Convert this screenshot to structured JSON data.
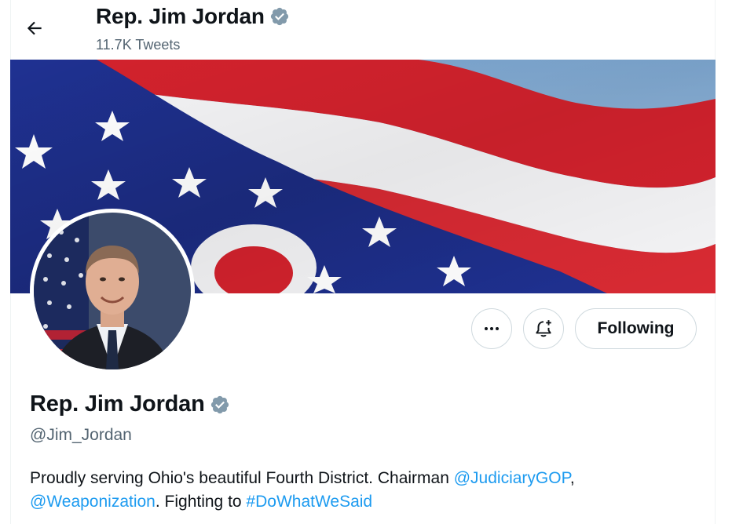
{
  "header": {
    "back_icon": "arrow-left-icon",
    "name": "Rep. Jim Jordan",
    "tweet_count": "11.7K Tweets",
    "verified_icon": "verified-badge-icon"
  },
  "banner": {
    "description_icon": "ohio-flag-banner-image",
    "colors": {
      "red": "#d3222d",
      "white": "#ffffff",
      "blue": "#1e2f8f",
      "sky": "#8cb3d6"
    }
  },
  "avatar": {
    "icon": "profile-photo-avatar"
  },
  "actions": {
    "more_icon": "more-dots-icon",
    "notify_icon": "bell-plus-icon",
    "follow_label": "Following"
  },
  "profile": {
    "name": "Rep. Jim Jordan",
    "handle": "@Jim_Jordan",
    "bio": {
      "text1": "Proudly serving Ohio's beautiful Fourth District. Chairman ",
      "mention1": "@JudiciaryGOP",
      "text2": ",",
      "mention2": "@Weaponization",
      "text3": ". Fighting to ",
      "hashtag": "#DoWhatWeSaid"
    }
  },
  "colors": {
    "link": "#1d9bf0",
    "muted": "#536471",
    "verified": "#829aab"
  }
}
